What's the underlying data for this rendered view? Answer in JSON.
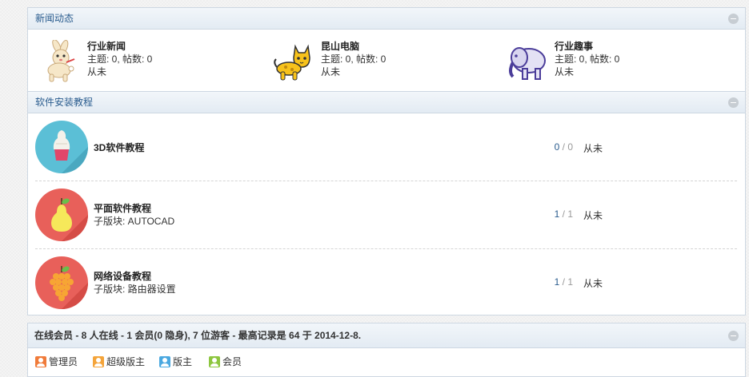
{
  "news_section": {
    "title": "新闻动态",
    "items": [
      {
        "name": "行业新闻",
        "stats": "主题: 0, 帖数: 0",
        "last": "从未",
        "icon": "rabbit-icon"
      },
      {
        "name": "昆山电脑",
        "stats": "主题: 0, 帖数: 0",
        "last": "从未",
        "icon": "cat-icon"
      },
      {
        "name": "行业趣事",
        "stats": "主题: 0, 帖数: 0",
        "last": "从未",
        "icon": "elephant-icon"
      }
    ]
  },
  "software_section": {
    "title": "软件安装教程",
    "forums": [
      {
        "name": "3D软件教程",
        "sub": "",
        "threads": "0",
        "sep": " / ",
        "posts": "0",
        "last": "从未",
        "icon": "icecream-icon",
        "color": "#5bbfd6"
      },
      {
        "name": "平面软件教程",
        "sub": "子版块: AUTOCAD",
        "threads": "1",
        "sep": " / ",
        "posts": "1",
        "last": "从未",
        "icon": "pear-icon",
        "color": "#e8605a"
      },
      {
        "name": "网络设备教程",
        "sub": "子版块: 路由器设置",
        "threads": "1",
        "sep": " / ",
        "posts": "1",
        "last": "从未",
        "icon": "grapes-icon",
        "color": "#e8605a"
      }
    ]
  },
  "online": {
    "title": "在线会员 - 8 人在线 - 1 会员(0 隐身), 7 位游客 - 最高记录是 64 于 2014-12-8.",
    "legend": [
      {
        "label": "管理员",
        "color": "#f07b3a"
      },
      {
        "label": "超级版主",
        "color": "#f4a43a"
      },
      {
        "label": "版主",
        "color": "#4aa8e0"
      },
      {
        "label": "会员",
        "color": "#8dc63f"
      }
    ]
  }
}
